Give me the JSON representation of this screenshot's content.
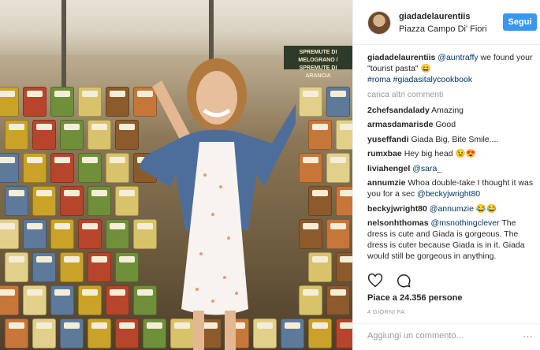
{
  "post": {
    "author": "giadadelaurentiis",
    "location": "Piazza Campo Di' Fiori",
    "follow_label": "Segui",
    "caption": {
      "author": "giadadelaurentiis",
      "mention": "@auntraffy",
      "text": " we found your \"tourist pasta\" 😄",
      "hashtags": "#roma #giadasitalycookbook"
    },
    "load_more": "carica altri commenti",
    "comments": [
      {
        "user": "2chefsandalady",
        "text": "Amazing"
      },
      {
        "user": "armasdamarisde",
        "text": "Good"
      },
      {
        "user": "yuseffandi",
        "text": "Giada Big, Bite Smile...."
      },
      {
        "user": "rumxbae",
        "text": "Hey big head 😉😍"
      },
      {
        "user": "liviahengel",
        "mention": "@sara_",
        "text": ""
      },
      {
        "user": "annumzie",
        "text": "Whoa double-take I thought it was you for a sec ",
        "mention": "@beckyjwright80"
      },
      {
        "user": "beckyjwright80",
        "mention": "@annumzie",
        "text": " 😂😂"
      },
      {
        "user": "nelsonhthomas",
        "mention": "@msnothingclever",
        "text": " The dress is cute and Giada is gorgeous. The dress is cuter because Giada is in it. Giada would still be gorgeous in anything."
      }
    ],
    "likes": "Piace a 24.356 persone",
    "date": "4 GIORNI FA",
    "add_comment_placeholder": "Aggiungi un commento...",
    "more_icon": "⋯"
  },
  "photo": {
    "sign_text": "SPREMUTE DI MELOGRANO / SPREMUTE DI ARANCIA"
  }
}
